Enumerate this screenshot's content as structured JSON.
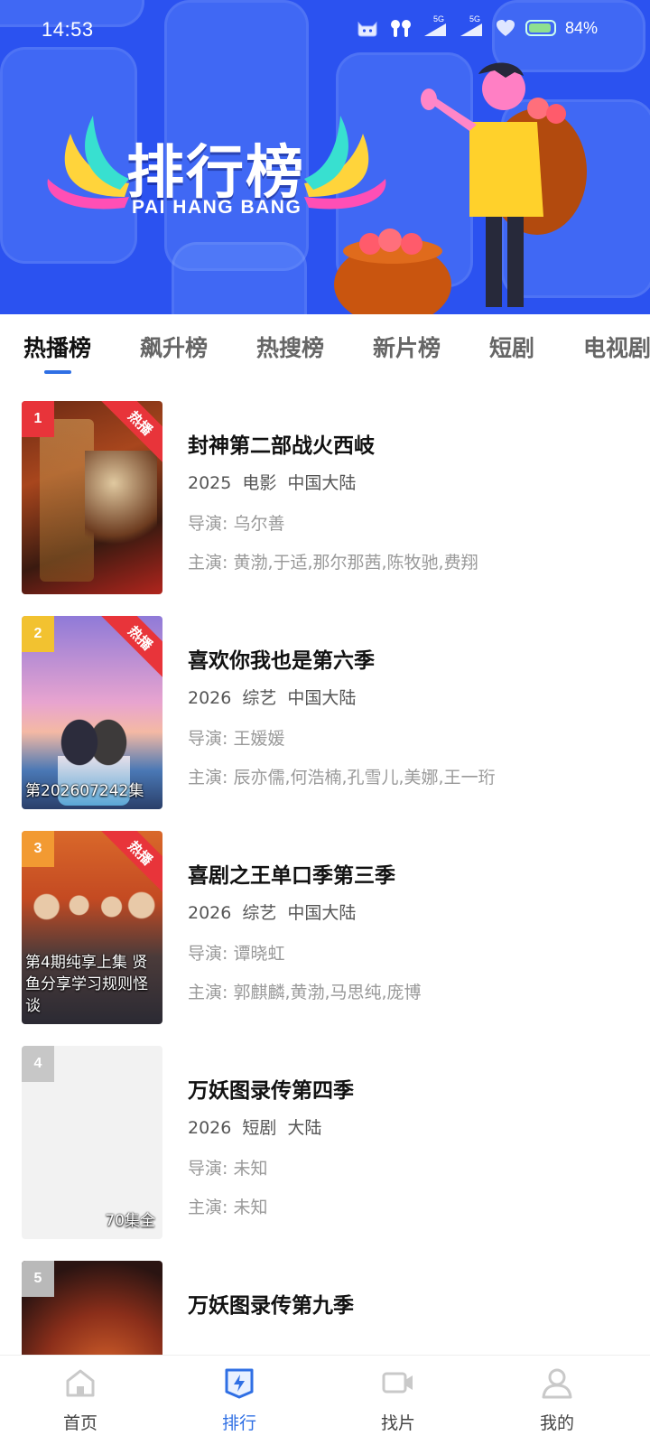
{
  "status_bar": {
    "time": "14:53",
    "battery": "84%",
    "network_labels": [
      "5G",
      "5G"
    ]
  },
  "banner": {
    "title": "排行榜",
    "subtitle": "PAI HANG BANG"
  },
  "tabs": [
    {
      "label": "热播榜",
      "active": true
    },
    {
      "label": "飙升榜",
      "active": false
    },
    {
      "label": "热搜榜",
      "active": false
    },
    {
      "label": "新片榜",
      "active": false
    },
    {
      "label": "短剧",
      "active": false
    },
    {
      "label": "电视剧",
      "active": false
    }
  ],
  "items": [
    {
      "rank": "1",
      "badge": "热播",
      "caption": "",
      "title": "封神第二部战火西岐",
      "year": "2025",
      "type": "电影",
      "region": "中国大陆",
      "director": "导演: 乌尔善",
      "cast": "主演: 黄渤,于适,那尔那茜,陈牧驰,费翔"
    },
    {
      "rank": "2",
      "badge": "热播",
      "caption": "第202607242集",
      "title": "喜欢你我也是第六季",
      "year": "2026",
      "type": "综艺",
      "region": "中国大陆",
      "director": "导演: 王媛媛",
      "cast": "主演: 辰亦儒,何浩楠,孔雪儿,美娜,王一珩"
    },
    {
      "rank": "3",
      "badge": "热播",
      "caption": "第4期纯享上集 贤鱼分享学习规则怪谈",
      "title": "喜剧之王单口季第三季",
      "year": "2026",
      "type": "综艺",
      "region": "中国大陆",
      "director": "导演: 谭晓虹",
      "cast": "主演: 郭麒麟,黄渤,马思纯,庞博"
    },
    {
      "rank": "4",
      "badge": "",
      "caption": "70集全",
      "title": "万妖图录传第四季",
      "year": "2026",
      "type": "短剧",
      "region": "大陆",
      "director": "导演: 未知",
      "cast": "主演: 未知"
    },
    {
      "rank": "5",
      "badge": "",
      "caption": "",
      "title": "万妖图录传第九季",
      "year": "",
      "type": "",
      "region": "",
      "director": "",
      "cast": ""
    }
  ],
  "bottom_nav": [
    {
      "label": "首页",
      "icon": "home-icon",
      "active": false
    },
    {
      "label": "排行",
      "icon": "ranking-icon",
      "active": true
    },
    {
      "label": "找片",
      "icon": "video-camera-icon",
      "active": false
    },
    {
      "label": "我的",
      "icon": "profile-icon",
      "active": false
    }
  ],
  "colors": {
    "banner_bg": "#2b52f0",
    "accent": "#2f6fe4",
    "hot_tag": "#e8343a"
  }
}
